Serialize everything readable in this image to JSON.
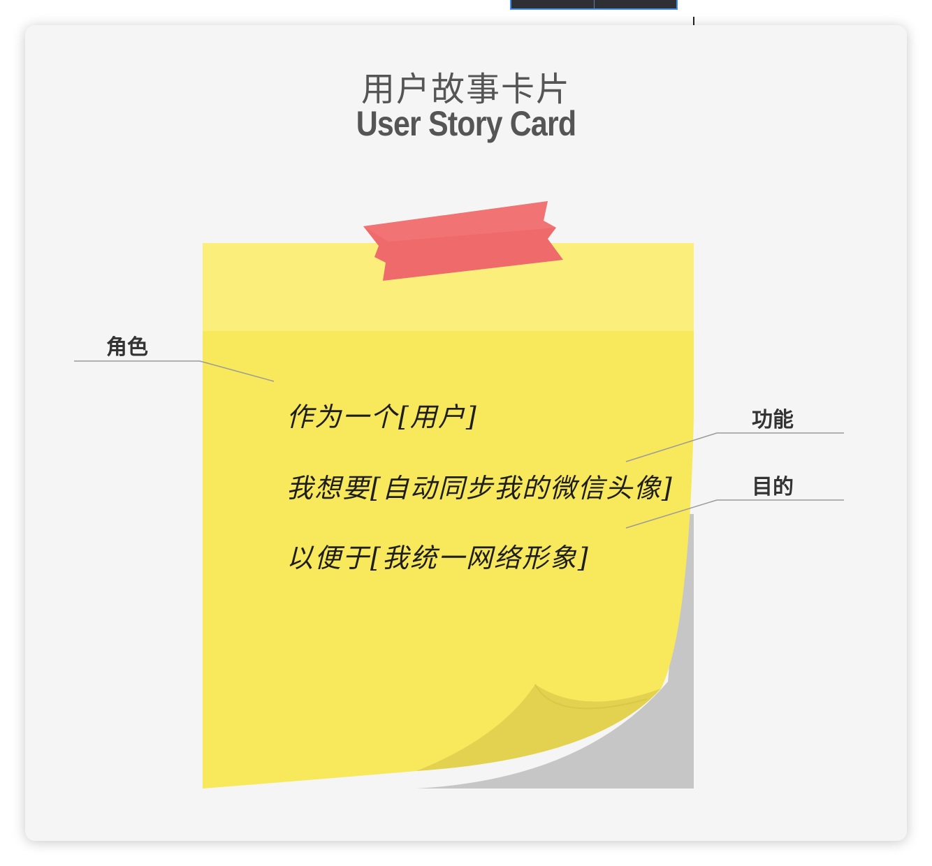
{
  "title": {
    "chinese": "用户故事卡片",
    "english": "User Story Card"
  },
  "labels": {
    "role": "角色",
    "feature": "功能",
    "goal": "目的"
  },
  "story": {
    "line1": "作为一个[用户]",
    "line2": "我想要[自动同步我的微信头像]",
    "line3": "以便于[我统一网络形象]"
  },
  "colors": {
    "note": "#f8e85c",
    "note_top": "#fbee7a",
    "tape": "#ef6a6a",
    "curl": "#e6d552",
    "shadow": "#c6c6c6"
  }
}
